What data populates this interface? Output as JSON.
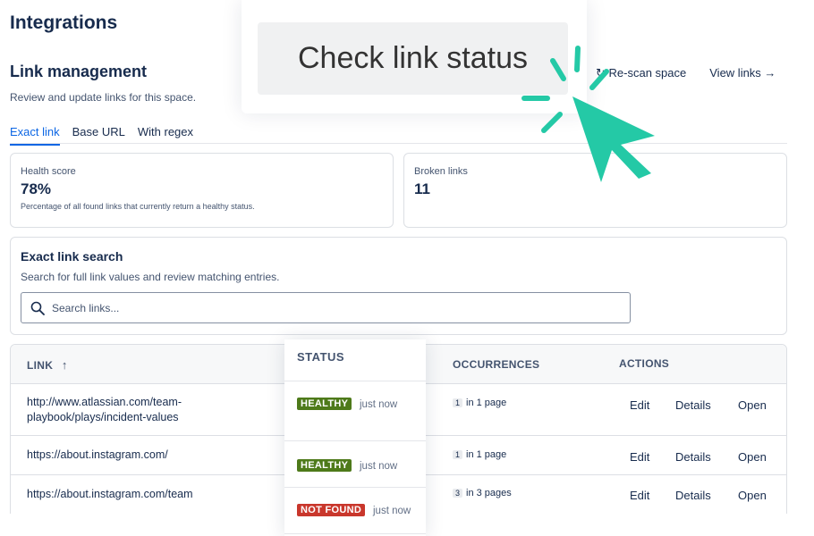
{
  "page": {
    "title": "Integrations"
  },
  "section": {
    "title": "Link management",
    "description": "Review and update links for this space."
  },
  "header_actions": {
    "rescan": "Re-scan space",
    "view_links": "View links →"
  },
  "tabs": [
    {
      "label": "Exact link",
      "active": true
    },
    {
      "label": "Base URL",
      "active": false
    },
    {
      "label": "With regex",
      "active": false
    }
  ],
  "metrics": {
    "health": {
      "label": "Health score",
      "value": "78%",
      "note": "Percentage of all found links that currently return a healthy status."
    },
    "broken": {
      "label": "Broken links",
      "value": "11"
    }
  },
  "search": {
    "title": "Exact link search",
    "description": "Search for full link values and review matching entries.",
    "placeholder": "Search links..."
  },
  "table": {
    "headers": {
      "link": "LINK",
      "status": "STATUS",
      "occurrences": "OCCURRENCES",
      "actions": "ACTIONS"
    },
    "rows": [
      {
        "link": "http://www.atlassian.com/team-playbook/plays/incident-values",
        "status": "HEALTHY",
        "status_time": "just now",
        "occ_count": "1",
        "occ_text": "in 1 page",
        "edit": "Edit",
        "details": "Details",
        "open": "Open"
      },
      {
        "link": "https://about.instagram.com/",
        "status": "HEALTHY",
        "status_time": "just now",
        "occ_count": "1",
        "occ_text": "in 1 page",
        "edit": "Edit",
        "details": "Details",
        "open": "Open"
      },
      {
        "link": "https://about.instagram.com/team",
        "status": "NOT FOUND",
        "status_time": "just now",
        "occ_count": "3",
        "occ_text": "in 3 pages",
        "edit": "Edit",
        "details": "Details",
        "open": "Open"
      }
    ]
  },
  "callout": {
    "label": "Check link status"
  },
  "colors": {
    "accent": "#0c66e4",
    "healthy": "#4e7a1a",
    "not_found": "#c9372c",
    "cursor": "#24c9a6"
  },
  "icons": [
    "refresh-icon",
    "arrow-right-icon",
    "search-icon",
    "sort-up-icon",
    "cursor-pointer-icon",
    "click-burst-icon"
  ]
}
